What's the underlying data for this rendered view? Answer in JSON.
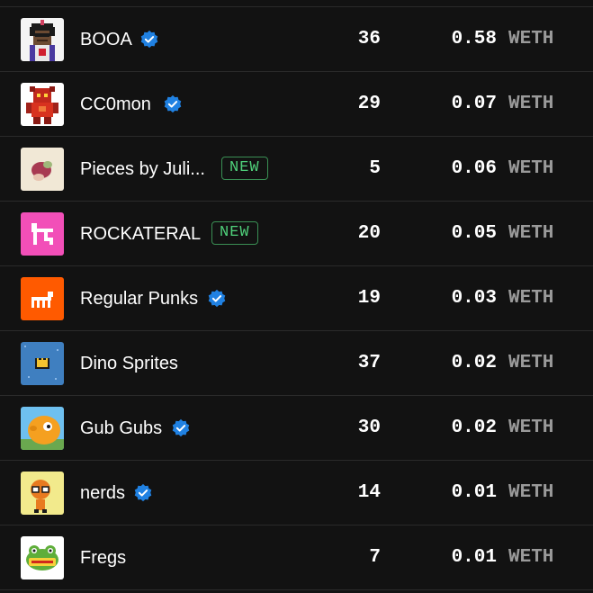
{
  "collections": [
    {
      "name": "BOOA",
      "verified": true,
      "badge": "",
      "count": "36",
      "price": "0.58",
      "currency": "WETH",
      "thumb_icon": "pixel-character-avatar"
    },
    {
      "name": "CC0mon",
      "verified": true,
      "badge": "",
      "count": "29",
      "price": "0.07",
      "currency": "WETH",
      "thumb_icon": "red-pixel-monster"
    },
    {
      "name": "Pieces by Juli...",
      "verified": false,
      "badge": "NEW",
      "count": "5",
      "price": "0.06",
      "currency": "WETH",
      "thumb_icon": "abstract-blob-art"
    },
    {
      "name": "ROCKATERAL",
      "verified": false,
      "badge": "NEW",
      "count": "20",
      "price": "0.05",
      "currency": "WETH",
      "thumb_icon": "pink-pixel-logo"
    },
    {
      "name": "Regular Punks",
      "verified": true,
      "badge": "",
      "count": "19",
      "price": "0.03",
      "currency": "WETH",
      "thumb_icon": "orange-punk-logo"
    },
    {
      "name": "Dino Sprites",
      "verified": false,
      "badge": "",
      "count": "37",
      "price": "0.02",
      "currency": "WETH",
      "thumb_icon": "blue-crown-sprite"
    },
    {
      "name": "Gub Gubs",
      "verified": true,
      "badge": "",
      "count": "30",
      "price": "0.02",
      "currency": "WETH",
      "thumb_icon": "orange-gub-creature"
    },
    {
      "name": "nerds",
      "verified": true,
      "badge": "",
      "count": "14",
      "price": "0.01",
      "currency": "WETH",
      "thumb_icon": "nerd-character"
    },
    {
      "name": "Fregs",
      "verified": false,
      "badge": "",
      "count": "7",
      "price": "0.01",
      "currency": "WETH",
      "thumb_icon": "frog-logo"
    }
  ],
  "colors": {
    "background": "#121212",
    "divider": "#2a2a2a",
    "verified_blue": "#2081e2",
    "badge_green": "#4fd07a",
    "currency_gray": "#9a9a9a"
  }
}
